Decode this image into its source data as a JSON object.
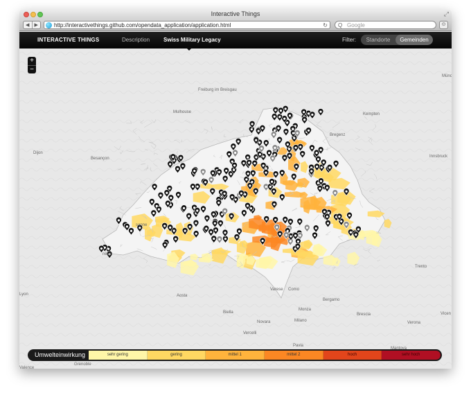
{
  "browser": {
    "title": "Interactive Things",
    "url": "http://interactivethings.github.com/opendata_application/application.html",
    "search_placeholder": "Google",
    "back_icon": "◀",
    "forward_icon": "▶",
    "reload_icon": "↻",
    "search_icon": "Q",
    "resize_icon": "⤢",
    "tab_icon": "⊙"
  },
  "nav": {
    "brand": "INTERACTIVE THINGS",
    "links": [
      "Description",
      "Swiss Military Legacy"
    ],
    "active": "Swiss Military Legacy",
    "filter_label": "Filter:",
    "filter_options": [
      "Standorte",
      "Gemeinden"
    ],
    "filter_selected": "Gemeinden"
  },
  "map": {
    "zoom_in": "+",
    "zoom_out": "−",
    "places": [
      {
        "name": "Freiburg im Breisgau"
      },
      {
        "name": "Mulhouse"
      },
      {
        "name": "Kempten"
      },
      {
        "name": "Bregenz"
      },
      {
        "name": "Dijon"
      },
      {
        "name": "Besançon"
      },
      {
        "name": "Innsbruck"
      },
      {
        "name": "Münch"
      },
      {
        "name": "Trento"
      },
      {
        "name": "Lyon"
      },
      {
        "name": "Aosta"
      },
      {
        "name": "Biella"
      },
      {
        "name": "Varese"
      },
      {
        "name": "Como"
      },
      {
        "name": "Bergamo"
      },
      {
        "name": "Brescia"
      },
      {
        "name": "Monza"
      },
      {
        "name": "Novara"
      },
      {
        "name": "Milano"
      },
      {
        "name": "Vicen"
      },
      {
        "name": "Verona"
      },
      {
        "name": "Vercelli"
      },
      {
        "name": "Grenoble"
      },
      {
        "name": "Pavia"
      },
      {
        "name": "Mantova"
      },
      {
        "name": "Valence"
      },
      {
        "name": "Asti"
      },
      {
        "name": "Alessandria"
      },
      {
        "name": "sanne"
      },
      {
        "name": "nève"
      }
    ],
    "colors": {
      "background": "#e9e9e9",
      "country": "#f6f6f6",
      "border": "#bdbdbd",
      "marker": "#111111",
      "marker_inactive": "#8a8a8a"
    }
  },
  "legend": {
    "title": "Umwelteinwirkung",
    "categories": [
      {
        "label": "sehr gering",
        "color": "#fff6a8"
      },
      {
        "label": "gering",
        "color": "#ffd862"
      },
      {
        "label": "mittel 1",
        "color": "#ffb33c"
      },
      {
        "label": "mittel 2",
        "color": "#fb8723"
      },
      {
        "label": "hoch",
        "color": "#e2451b"
      },
      {
        "label": "sehr hoch",
        "color": "#b00f23"
      }
    ]
  }
}
